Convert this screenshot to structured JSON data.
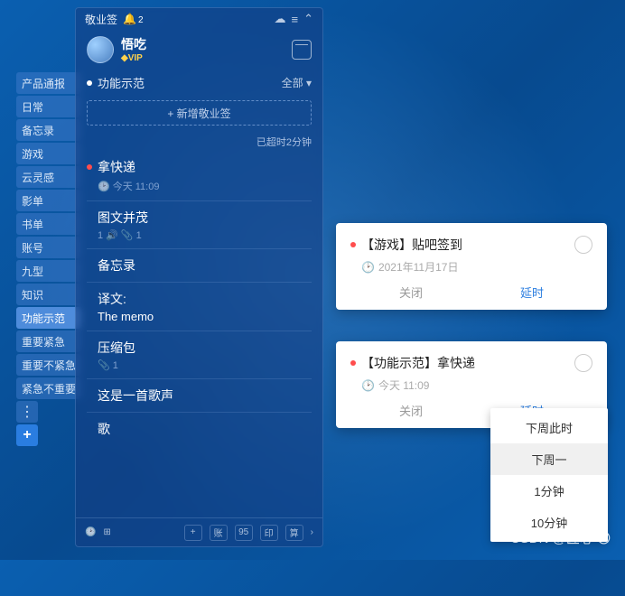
{
  "sidebar": {
    "tags": [
      {
        "label": "产品通报"
      },
      {
        "label": "日常"
      },
      {
        "label": "备忘录"
      },
      {
        "label": "游戏"
      },
      {
        "label": "云灵感"
      },
      {
        "label": "影单"
      },
      {
        "label": "书单"
      },
      {
        "label": "账号"
      },
      {
        "label": "九型"
      },
      {
        "label": "知识"
      },
      {
        "label": "功能示范",
        "active": true
      },
      {
        "label": "重要紧急"
      },
      {
        "label": "重要不紧急"
      },
      {
        "label": "紧急不重要"
      }
    ]
  },
  "panel": {
    "app_name": "敬业签",
    "bell_count": "2",
    "user_name": "悟吃",
    "vip": "◆VIP",
    "category": "功能示范",
    "category_right": "全部 ▾",
    "add_label": "+ 新增敬业签",
    "overdue": "已超时2分钟",
    "notes": [
      {
        "title": "拿快递",
        "red": true,
        "sub_icon": "clock",
        "sub": "今天 11:09"
      },
      {
        "title": "图文并茂",
        "red": false,
        "sub_icon": "attach",
        "sub": "1 🔊 📎 1"
      },
      {
        "title": "备忘录",
        "red": false
      },
      {
        "title": "译文:",
        "red": false,
        "translation": "The memo"
      },
      {
        "title": "压缩包",
        "red": false,
        "sub_icon": "attach",
        "sub": "📎 1"
      },
      {
        "title": "这是一首歌声",
        "red": false
      },
      {
        "title": "歌",
        "red": false
      }
    ],
    "footer_icons": [
      "⏱",
      "⊞",
      "",
      "+",
      "账",
      "95",
      "印",
      "算"
    ]
  },
  "reminder1": {
    "title": "【游戏】贴吧签到",
    "time": "2021年11月17日",
    "close": "关闭",
    "delay": "延时"
  },
  "reminder2": {
    "title": "【功能示范】拿快递",
    "time": "今天 11:09",
    "close": "关闭",
    "delay": "延时"
  },
  "dropdown": {
    "items": [
      "下周此时",
      "下周一",
      "1分钟",
      "10分钟"
    ]
  },
  "watermark": "CSDN @匠心 〇"
}
